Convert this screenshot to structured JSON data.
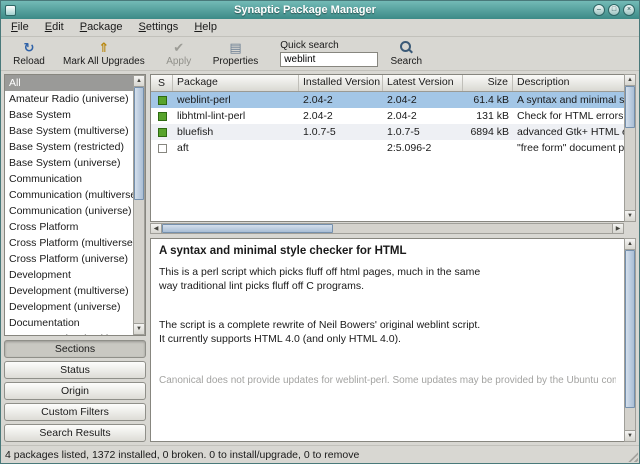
{
  "theme": {
    "titlebar_color": "#3c8a87",
    "selection_color": "#a3c6e6",
    "installed_color": "#58a42c"
  },
  "window": {
    "title": "Synaptic Package Manager"
  },
  "menubar": {
    "items": [
      {
        "label": "File"
      },
      {
        "label": "Edit"
      },
      {
        "label": "Package"
      },
      {
        "label": "Settings"
      },
      {
        "label": "Help"
      }
    ]
  },
  "toolbar": {
    "buttons": [
      {
        "label": "Reload",
        "icon": "reload-icon"
      },
      {
        "label": "Mark All Upgrades",
        "icon": "mark-upgrades-icon"
      },
      {
        "label": "Apply",
        "icon": "apply-icon",
        "disabled": true
      },
      {
        "label": "Properties",
        "icon": "properties-icon"
      }
    ],
    "quick_search_label": "Quick search",
    "search_value": "weblint",
    "search_button_label": "Search"
  },
  "sidebar": {
    "items": [
      {
        "label": "All",
        "selected": true
      },
      {
        "label": "Amateur Radio (universe)"
      },
      {
        "label": "Base System"
      },
      {
        "label": "Base System (multiverse)"
      },
      {
        "label": "Base System (restricted)"
      },
      {
        "label": "Base System (universe)"
      },
      {
        "label": "Communication"
      },
      {
        "label": "Communication (multiverse)"
      },
      {
        "label": "Communication (universe)"
      },
      {
        "label": "Cross Platform"
      },
      {
        "label": "Cross Platform (multiverse)"
      },
      {
        "label": "Cross Platform (universe)"
      },
      {
        "label": "Development"
      },
      {
        "label": "Development (multiverse)"
      },
      {
        "label": "Development (universe)"
      },
      {
        "label": "Documentation"
      },
      {
        "label": "Documentation (multiverse)"
      }
    ],
    "buttons": [
      {
        "label": "Sections",
        "pressed": true
      },
      {
        "label": "Status"
      },
      {
        "label": "Origin"
      },
      {
        "label": "Custom Filters"
      },
      {
        "label": "Search Results"
      }
    ]
  },
  "table": {
    "columns": [
      "S",
      "Package",
      "Installed Version",
      "Latest Version",
      "Size",
      "Description"
    ],
    "rows": [
      {
        "status": "installed",
        "selected": true,
        "package": "weblint-perl",
        "installed": "2.04-2",
        "latest": "2.04-2",
        "size": "61.4 kB",
        "description": "A syntax and minimal style che"
      },
      {
        "status": "installed",
        "package": "libhtml-lint-perl",
        "installed": "2.04-2",
        "latest": "2.04-2",
        "size": "131 kB",
        "description": "Check for HTML errors in a"
      },
      {
        "status": "installed",
        "package": "bluefish",
        "installed": "1.0.7-5",
        "latest": "1.0.7-5",
        "size": "6894 kB",
        "description": "advanced Gtk+ HTML editor"
      },
      {
        "status": "not-installed",
        "package": "aft",
        "installed": "",
        "latest": "2:5.096-2",
        "size": "",
        "description": "\"free form\" document preparati"
      }
    ]
  },
  "details": {
    "title": "A syntax and minimal style checker for HTML",
    "lines": [
      "This is a perl script which picks fluff off html pages, much in the same",
      "way traditional lint picks fluff off C programs.",
      "",
      "",
      "The script is a complete rewrite of Neil Bowers' original weblint script.",
      "It currently supports HTML 4.0 (and only HTML 4.0)."
    ],
    "note": "Canonical does not provide updates for weblint-perl. Some updates may be provided by the Ubuntu community."
  },
  "statusbar": {
    "text": "4 packages listed, 1372 installed, 0 broken. 0 to install/upgrade, 0 to remove"
  }
}
